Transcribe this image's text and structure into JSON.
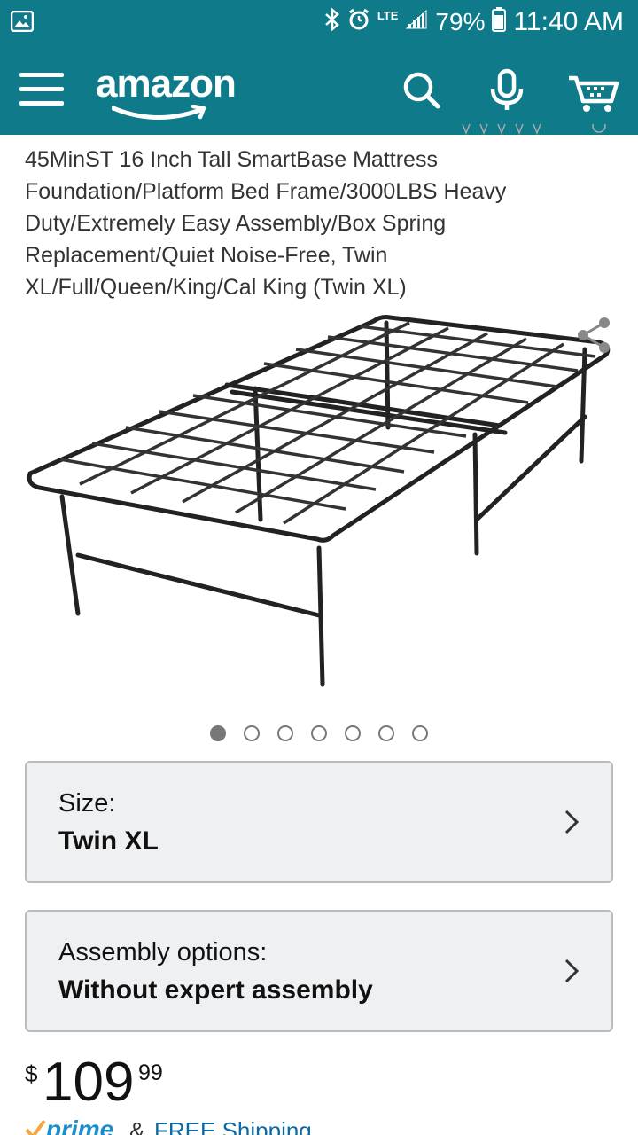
{
  "status_bar": {
    "network": "LTE",
    "battery_percent": "79%",
    "time": "11:40 AM",
    "icons": [
      "image-icon",
      "bluetooth-icon",
      "alarm-icon",
      "signal-icon",
      "battery-icon"
    ]
  },
  "header": {
    "logo_text": "amazon",
    "color": "#0f7b8a",
    "icons": [
      "menu-icon",
      "search-icon",
      "microphone-icon",
      "cart-icon"
    ]
  },
  "product": {
    "title": "45MinST 16 Inch Tall SmartBase Mattress Foundation/Platform Bed Frame/3000LBS Heavy Duty/Extremely Easy Assembly/Box Spring Replacement/Quiet Noise-Free, Twin XL/Full/Queen/King/Cal King (Twin XL)",
    "image_count": 7,
    "active_image_index": 0
  },
  "options": [
    {
      "label": "Size:",
      "value": "Twin XL"
    },
    {
      "label": "Assembly options:",
      "value": "Without expert assembly"
    }
  ],
  "price": {
    "currency": "$",
    "whole": "109",
    "fraction": "99"
  },
  "shipping": {
    "prime_label": "prime",
    "amp": "&",
    "text": "FREE Shipping"
  }
}
